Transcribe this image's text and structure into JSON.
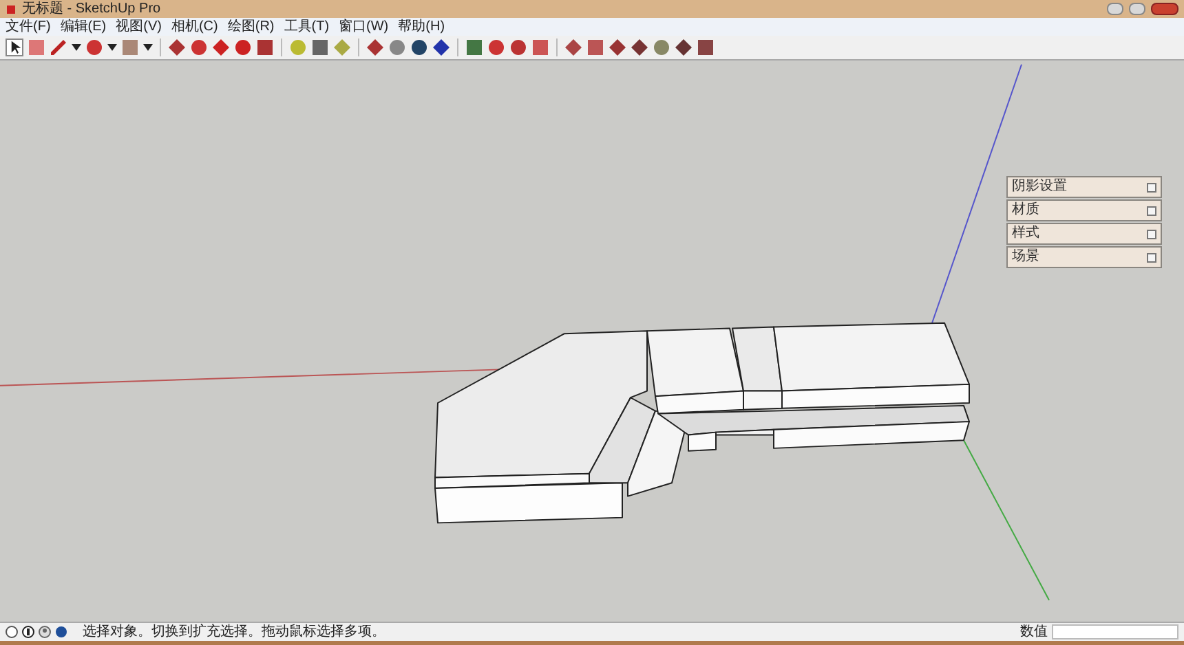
{
  "window": {
    "title": "无标题 - SketchUp Pro"
  },
  "menu": [
    "文件(F)",
    "编辑(E)",
    "视图(V)",
    "相机(C)",
    "绘图(R)",
    "工具(T)",
    "窗口(W)",
    "帮助(H)"
  ],
  "panels": [
    {
      "title": "阴影设置",
      "expanded": false
    },
    {
      "title": "材质",
      "expanded": false
    },
    {
      "title": "样式",
      "expanded": false
    },
    {
      "title": "场景",
      "expanded": false
    }
  ],
  "status_bar": {
    "message": "选择对象。切换到扩充选择。拖动鼠标选择多项。",
    "value_label": "数值"
  }
}
